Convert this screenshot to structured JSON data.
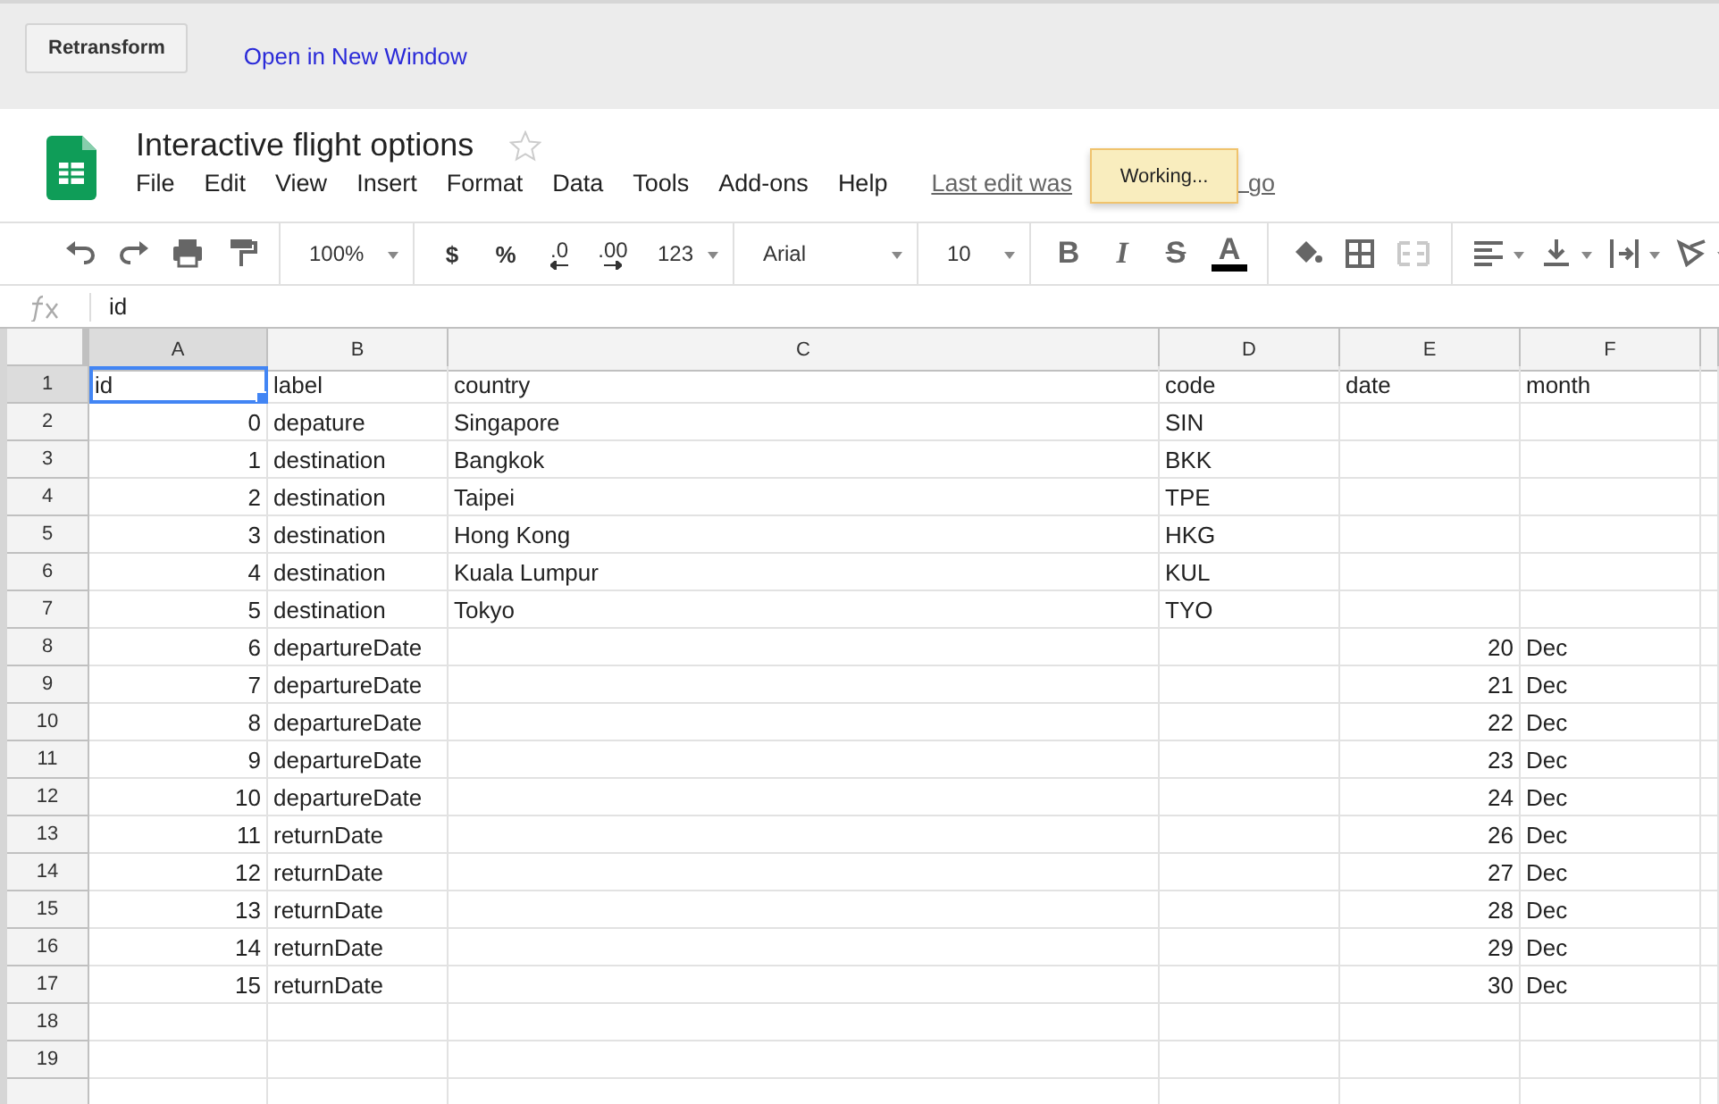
{
  "topbar": {
    "button": "Retransform",
    "link": "Open in New Window"
  },
  "document": {
    "title": "Interactive flight options",
    "starred": false,
    "menu": [
      "File",
      "Edit",
      "View",
      "Insert",
      "Format",
      "Data",
      "Tools",
      "Add-ons",
      "Help"
    ],
    "last_edit_visible": "Last edit was",
    "last_edit_tail": "go",
    "notice": "Working..."
  },
  "toolbar": [
    {
      "kind": "undo"
    },
    {
      "kind": "redo"
    },
    {
      "kind": "print"
    },
    {
      "kind": "paint"
    },
    {
      "kind": "sep"
    },
    {
      "kind": "zoom",
      "label": "100%"
    },
    {
      "kind": "sep"
    },
    {
      "kind": "text",
      "label": "$"
    },
    {
      "kind": "text",
      "label": "%"
    },
    {
      "kind": "decdown",
      "label": ".0"
    },
    {
      "kind": "decup",
      "label": ".00"
    },
    {
      "kind": "numfmt",
      "label": "123"
    },
    {
      "kind": "sep"
    },
    {
      "kind": "font",
      "label": "Arial"
    },
    {
      "kind": "sep"
    },
    {
      "kind": "size",
      "label": "10"
    },
    {
      "kind": "sep"
    },
    {
      "kind": "bold",
      "label": "B"
    },
    {
      "kind": "italic",
      "label": "I"
    },
    {
      "kind": "strike",
      "label": "S"
    },
    {
      "kind": "textcolor",
      "label": "A",
      "color": "#000000"
    },
    {
      "kind": "sep"
    },
    {
      "kind": "fill"
    },
    {
      "kind": "borders"
    },
    {
      "kind": "merge",
      "disabled": true
    },
    {
      "kind": "sep"
    },
    {
      "kind": "halign"
    },
    {
      "kind": "valign"
    },
    {
      "kind": "wrap"
    },
    {
      "kind": "rotate"
    }
  ],
  "formula_bar": {
    "value": "id"
  },
  "sheet": {
    "columns": [
      {
        "label": "A",
        "selected": true
      },
      {
        "label": "B",
        "selected": false
      },
      {
        "label": "C",
        "selected": false
      },
      {
        "label": "D",
        "selected": false
      },
      {
        "label": "E",
        "selected": false
      },
      {
        "label": "F",
        "selected": false
      }
    ],
    "rows": [
      {
        "number": "1",
        "selected": true,
        "cells": [
          "id",
          "label",
          "country",
          "code",
          "date",
          "month"
        ]
      },
      {
        "number": "2",
        "selected": false,
        "cells": [
          "0",
          "depature",
          "Singapore",
          "SIN",
          "",
          ""
        ]
      },
      {
        "number": "3",
        "selected": false,
        "cells": [
          "1",
          "destination",
          "Bangkok",
          "BKK",
          "",
          ""
        ]
      },
      {
        "number": "4",
        "selected": false,
        "cells": [
          "2",
          "destination",
          "Taipei",
          "TPE",
          "",
          ""
        ]
      },
      {
        "number": "5",
        "selected": false,
        "cells": [
          "3",
          "destination",
          "Hong Kong",
          "HKG",
          "",
          ""
        ]
      },
      {
        "number": "6",
        "selected": false,
        "cells": [
          "4",
          "destination",
          "Kuala Lumpur",
          "KUL",
          "",
          ""
        ]
      },
      {
        "number": "7",
        "selected": false,
        "cells": [
          "5",
          "destination",
          "Tokyo",
          "TYO",
          "",
          ""
        ]
      },
      {
        "number": "8",
        "selected": false,
        "cells": [
          "6",
          "departureDate",
          "",
          "",
          "20",
          "Dec"
        ]
      },
      {
        "number": "9",
        "selected": false,
        "cells": [
          "7",
          "departureDate",
          "",
          "",
          "21",
          "Dec"
        ]
      },
      {
        "number": "10",
        "selected": false,
        "cells": [
          "8",
          "departureDate",
          "",
          "",
          "22",
          "Dec"
        ]
      },
      {
        "number": "11",
        "selected": false,
        "cells": [
          "9",
          "departureDate",
          "",
          "",
          "23",
          "Dec"
        ]
      },
      {
        "number": "12",
        "selected": false,
        "cells": [
          "10",
          "departureDate",
          "",
          "",
          "24",
          "Dec"
        ]
      },
      {
        "number": "13",
        "selected": false,
        "cells": [
          "11",
          "returnDate",
          "",
          "",
          "26",
          "Dec"
        ]
      },
      {
        "number": "14",
        "selected": false,
        "cells": [
          "12",
          "returnDate",
          "",
          "",
          "27",
          "Dec"
        ]
      },
      {
        "number": "15",
        "selected": false,
        "cells": [
          "13",
          "returnDate",
          "",
          "",
          "28",
          "Dec"
        ]
      },
      {
        "number": "16",
        "selected": false,
        "cells": [
          "14",
          "returnDate",
          "",
          "",
          "29",
          "Dec"
        ]
      },
      {
        "number": "17",
        "selected": false,
        "cells": [
          "15",
          "returnDate",
          "",
          "",
          "30",
          "Dec"
        ]
      },
      {
        "number": "18",
        "selected": false,
        "cells": [
          "",
          "",
          "",
          "",
          "",
          ""
        ]
      },
      {
        "number": "19",
        "selected": false,
        "cells": [
          "",
          "",
          "",
          "",
          "",
          ""
        ]
      }
    ]
  }
}
